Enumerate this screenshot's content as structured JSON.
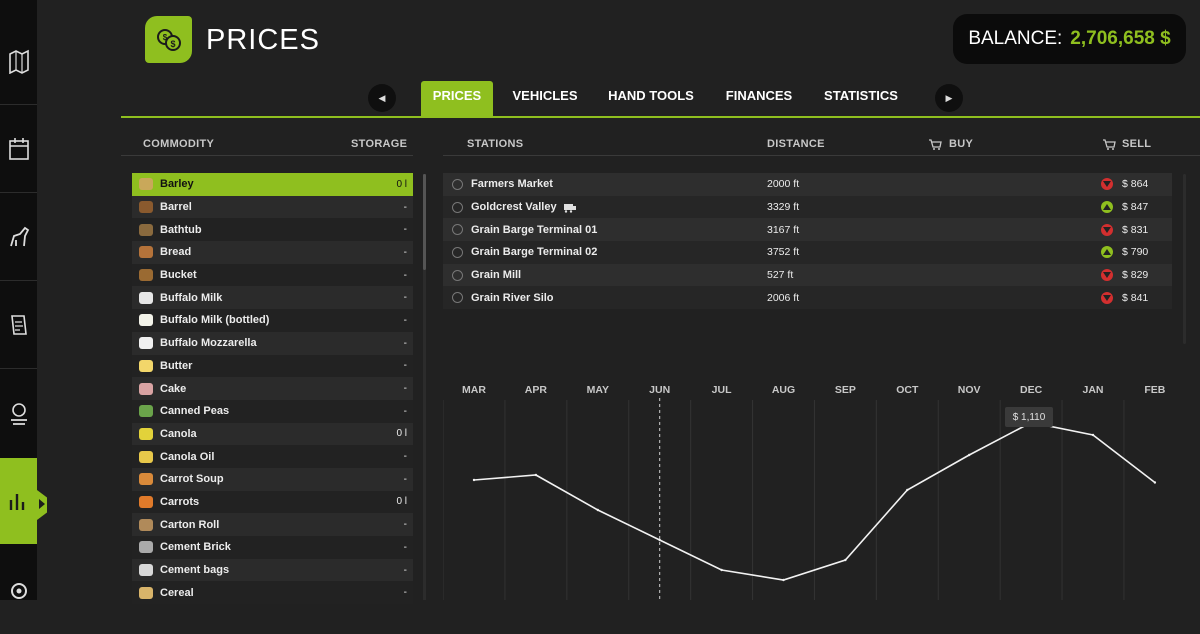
{
  "header": {
    "title": "PRICES",
    "balance_label": "BALANCE:",
    "balance_value": "2,706,658 $"
  },
  "sidebar": {
    "items": [
      {
        "icon": "map-icon"
      },
      {
        "icon": "calendar-icon"
      },
      {
        "icon": "animals-icon"
      },
      {
        "icon": "contracts-icon"
      },
      {
        "icon": "production-icon"
      },
      {
        "icon": "prices-chart-icon",
        "active": true
      },
      {
        "icon": "settings-icon"
      }
    ]
  },
  "tabs": {
    "prev_label": "◀",
    "next_label": "▶",
    "items": [
      {
        "label": "PRICES",
        "active": true
      },
      {
        "label": "VEHICLES"
      },
      {
        "label": "HAND TOOLS"
      },
      {
        "label": "FINANCES"
      },
      {
        "label": "STATISTICS"
      }
    ]
  },
  "columns": {
    "commodity": "COMMODITY",
    "storage": "STORAGE",
    "stations": "STATIONS",
    "distance": "DISTANCE",
    "buy": "BUY",
    "sell": "SELL"
  },
  "commodities": [
    {
      "name": "Barley",
      "storage": "0 l",
      "color": "#c9a85a"
    },
    {
      "name": "Barrel",
      "storage": "-",
      "color": "#8a5a2e"
    },
    {
      "name": "Bathtub",
      "storage": "-",
      "color": "#8a6a3e"
    },
    {
      "name": "Bread",
      "storage": "-",
      "color": "#b5733a"
    },
    {
      "name": "Bucket",
      "storage": "-",
      "color": "#9a6a32"
    },
    {
      "name": "Buffalo Milk",
      "storage": "-",
      "color": "#e6e6e6"
    },
    {
      "name": "Buffalo Milk (bottled)",
      "storage": "-",
      "color": "#f2f2e8"
    },
    {
      "name": "Buffalo Mozzarella",
      "storage": "-",
      "color": "#f0f0f0"
    },
    {
      "name": "Butter",
      "storage": "-",
      "color": "#f2d66a"
    },
    {
      "name": "Cake",
      "storage": "-",
      "color": "#d9a3a3"
    },
    {
      "name": "Canned Peas",
      "storage": "-",
      "color": "#6aa34a"
    },
    {
      "name": "Canola",
      "storage": "0 l",
      "color": "#e2d23a"
    },
    {
      "name": "Canola Oil",
      "storage": "-",
      "color": "#e8c84a"
    },
    {
      "name": "Carrot Soup",
      "storage": "-",
      "color": "#d98a3a"
    },
    {
      "name": "Carrots",
      "storage": "0 l",
      "color": "#e07a2a"
    },
    {
      "name": "Carton Roll",
      "storage": "-",
      "color": "#b08a5a"
    },
    {
      "name": "Cement Brick",
      "storage": "-",
      "color": "#aaaaaa"
    },
    {
      "name": "Cement bags",
      "storage": "-",
      "color": "#d8d8d8"
    },
    {
      "name": "Cereal",
      "storage": "-",
      "color": "#d8b46a"
    }
  ],
  "stations": [
    {
      "name": "Farmers Market",
      "distance": "2000 ft",
      "trend": "down",
      "price": "$ 864",
      "train": false
    },
    {
      "name": "Goldcrest Valley",
      "distance": "3329 ft",
      "trend": "up",
      "price": "$ 847",
      "train": true
    },
    {
      "name": "Grain Barge Terminal 01",
      "distance": "3167 ft",
      "trend": "down",
      "price": "$ 831",
      "train": false
    },
    {
      "name": "Grain Barge Terminal 02",
      "distance": "3752 ft",
      "trend": "up",
      "price": "$ 790",
      "train": false
    },
    {
      "name": "Grain Mill",
      "distance": "527 ft",
      "trend": "down",
      "price": "$ 829",
      "train": false
    },
    {
      "name": "Grain River Silo",
      "distance": "2006 ft",
      "trend": "down",
      "price": "$ 841",
      "train": false
    }
  ],
  "colors": {
    "accent": "#8fbf1f",
    "trend_up": "#8fbf1f",
    "trend_down": "#d32f2f"
  },
  "chart_data": {
    "type": "line",
    "categories": [
      "MAR",
      "APR",
      "MAY",
      "JUN",
      "JUL",
      "AUG",
      "SEP",
      "OCT",
      "NOV",
      "DEC",
      "JAN",
      "FEB"
    ],
    "values": [
      880,
      900,
      760,
      640,
      520,
      480,
      560,
      840,
      980,
      1110,
      1060,
      870
    ],
    "current_month": "JUN",
    "tooltip": "$ 1,110",
    "tooltip_month": "DEC",
    "grid": true
  }
}
